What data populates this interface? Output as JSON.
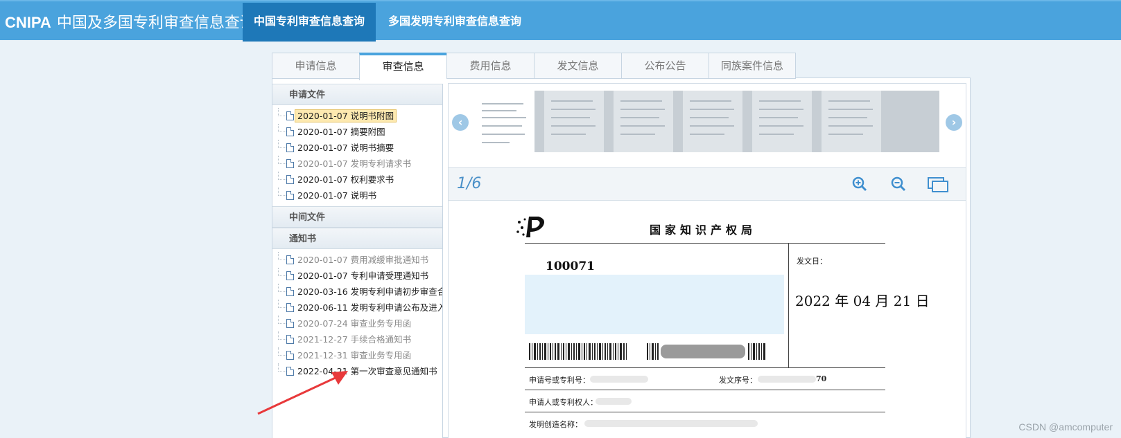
{
  "header": {
    "brand": "CNIPA",
    "title": "中国及多国专利审查信息查询",
    "nav": [
      {
        "label": "中国专利审查信息查询",
        "active": true
      },
      {
        "label": "多国发明专利审查信息查询",
        "active": false
      }
    ]
  },
  "tabs": [
    {
      "label": "申请信息",
      "active": false
    },
    {
      "label": "审查信息",
      "active": true
    },
    {
      "label": "费用信息",
      "active": false
    },
    {
      "label": "发文信息",
      "active": false
    },
    {
      "label": "公布公告",
      "active": false
    },
    {
      "label": "同族案件信息",
      "active": false
    }
  ],
  "tree": {
    "groups": [
      {
        "title": "申请文件",
        "items": [
          {
            "text": "2020-01-07 说明书附图",
            "selected": true,
            "grey": false
          },
          {
            "text": "2020-01-07 摘要附图",
            "selected": false,
            "grey": false
          },
          {
            "text": "2020-01-07 说明书摘要",
            "selected": false,
            "grey": false
          },
          {
            "text": "2020-01-07 发明专利请求书",
            "selected": false,
            "grey": true
          },
          {
            "text": "2020-01-07 权利要求书",
            "selected": false,
            "grey": false
          },
          {
            "text": "2020-01-07 说明书",
            "selected": false,
            "grey": false
          }
        ]
      },
      {
        "title": "中间文件",
        "items": []
      },
      {
        "title": "通知书",
        "items": [
          {
            "text": "2020-01-07 费用减缓审批通知书",
            "selected": false,
            "grey": true
          },
          {
            "text": "2020-01-07 专利申请受理通知书",
            "selected": false,
            "grey": false
          },
          {
            "text": "2020-03-16 发明专利申请初步审查合",
            "selected": false,
            "grey": false
          },
          {
            "text": "2020-06-11 发明专利申请公布及进入",
            "selected": false,
            "grey": false
          },
          {
            "text": "2020-07-24 审查业务专用函",
            "selected": false,
            "grey": true
          },
          {
            "text": "2021-12-27 手续合格通知书",
            "selected": false,
            "grey": true
          },
          {
            "text": "2021-12-31 审查业务专用函",
            "selected": false,
            "grey": true
          },
          {
            "text": "2022-04-21 第一次审查意见通知书",
            "selected": false,
            "grey": false
          }
        ]
      }
    ]
  },
  "viewer": {
    "pager": "1/6",
    "prev_icon": "chevron-left-icon",
    "next_icon": "chevron-right-icon",
    "tools": [
      "zoom-in-icon",
      "zoom-out-icon",
      "fit-page-icon"
    ]
  },
  "document": {
    "office": "国家知识产权局",
    "postal_code": "100071",
    "date_label": "发文日：",
    "date_value": "2022 年 04 月 21 日",
    "app_no_label": "申请号或专利号：",
    "serial_label": "发文序号：",
    "serial_suffix": "70",
    "applicant_label": "申请人或专利权人：",
    "invention_label": "发明创造名称："
  },
  "watermark": "CSDN @amcomputer",
  "colors": {
    "header": "#4aa3dd",
    "active_nav": "#1e78b8",
    "selected_item": "#fde9b0",
    "arrow": "#e8393b"
  }
}
